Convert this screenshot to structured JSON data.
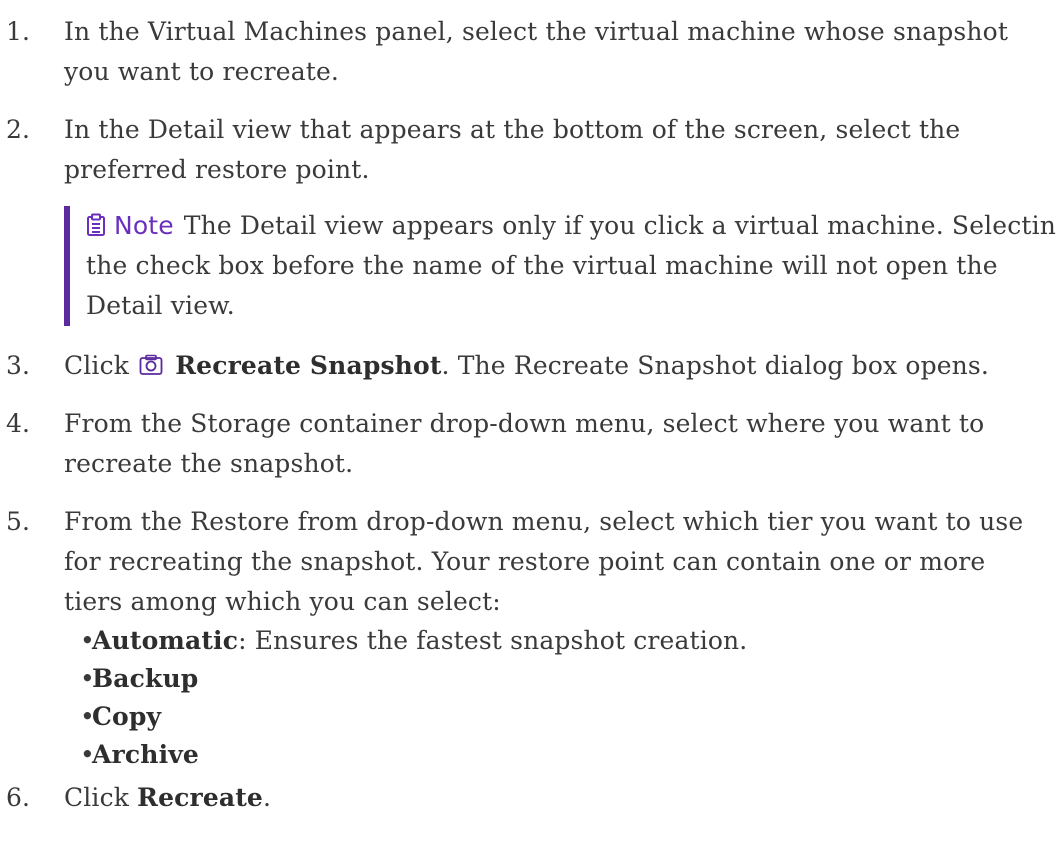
{
  "steps": [
    {
      "number": "1.",
      "text": "In the Virtual Machines panel, select the virtual machine whose snapshot you want to recreate."
    },
    {
      "number": "2.",
      "text": "In the Detail view that appears at the bottom of the screen, select the preferred restore point."
    },
    {
      "number": "3.",
      "prefix": "Click",
      "icon": "camera-icon",
      "bold": "Recreate Snapshot",
      "suffix": ". The Recreate Snapshot dialog box opens."
    },
    {
      "number": "4.",
      "text": "From the Storage container drop-down menu, select where you want to recreate the snapshot."
    },
    {
      "number": "5.",
      "text": "From the Restore from drop-down menu, select which tier you want to use for recreating the snapshot. Your restore point can contain one or more tiers among which you can select:"
    },
    {
      "number": "6.",
      "prefix": "Click",
      "bold": "Recreate",
      "suffix": "."
    }
  ],
  "note": {
    "icon": "clipboard-icon",
    "label": "Note",
    "text": "The Detail view appears only if you click a virtual machine. Selecting the check box before the name of the virtual machine will not open the Detail view.",
    "accent_color": "#5b2a9e"
  },
  "tiers": [
    {
      "bullet": "•",
      "name": "Automatic",
      "desc": ": Ensures the fastest snapshot creation."
    },
    {
      "bullet": "•",
      "name": "Backup",
      "desc": ""
    },
    {
      "bullet": "•",
      "name": "Copy",
      "desc": ""
    },
    {
      "bullet": "•",
      "name": "Archive",
      "desc": ""
    }
  ]
}
